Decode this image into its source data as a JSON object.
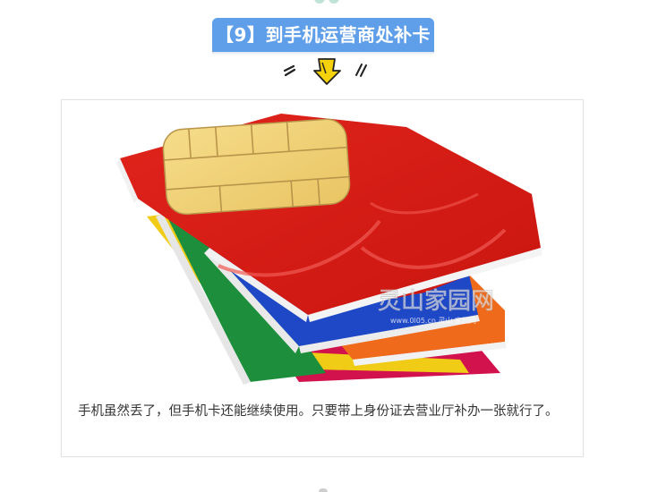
{
  "heading": {
    "text": "【9】到手机运营商处补卡",
    "color": "#5f9ee8"
  },
  "decorations": {
    "top": "leaf-ornament-icon",
    "arrow_left": "double-slash-icon",
    "arrow_center": "yellow-down-arrow-icon",
    "arrow_right": "double-slash-icon",
    "arrow_color": "#f5d20b"
  },
  "image": {
    "subject": "sim-cards-photo",
    "watermark_main": "灵山家园网",
    "watermark_url": "www.0l05.cn 灵山 家园网"
  },
  "caption": "手机虽然丢了，但手机卡还能继续使用。只要带上身份证去营业厅补办一张就行了。"
}
